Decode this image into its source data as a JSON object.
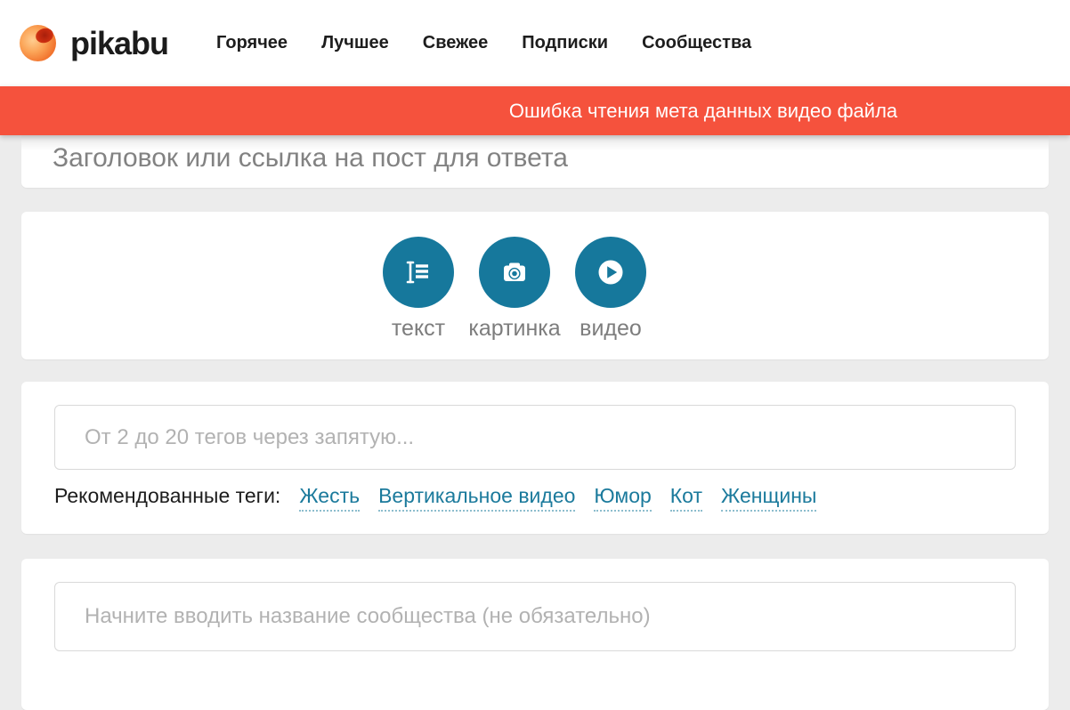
{
  "header": {
    "brand": "pikabu",
    "nav_items": [
      {
        "label": "Горячее"
      },
      {
        "label": "Лучшее"
      },
      {
        "label": "Свежее"
      },
      {
        "label": "Подписки"
      },
      {
        "label": "Сообщества"
      }
    ]
  },
  "error_banner": {
    "message": "Ошибка чтения мета данных видео файла",
    "background_color": "#f5523d",
    "text_color": "#ffffff"
  },
  "post_form": {
    "title": {
      "placeholder": "Заголовок или ссылка на пост для ответа"
    },
    "content_buttons": {
      "circle_color": "#16789c",
      "items": [
        {
          "label": "текст",
          "icon": "text-block-icon"
        },
        {
          "label": "картинка",
          "icon": "camera-icon"
        },
        {
          "label": "видео",
          "icon": "play-icon"
        }
      ]
    },
    "tags": {
      "placeholder": "От 2 до 20 тегов через запятую...",
      "recommended_label": "Рекомендованные теги:",
      "recommended_tags": [
        "Жесть",
        "Вертикальное видео",
        "Юмор",
        "Кот",
        "Женщины"
      ],
      "tag_link_color": "#1b7a9c"
    },
    "community": {
      "placeholder": "Начните вводить название сообщества (не обязательно)"
    }
  }
}
